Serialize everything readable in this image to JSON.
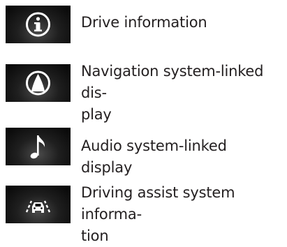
{
  "items": [
    {
      "icon": "info-icon",
      "label": "Drive information"
    },
    {
      "icon": "navigation-arrow-icon",
      "label": "Navigation system-linked dis-\nplay"
    },
    {
      "icon": "music-note-icon",
      "label": "Audio system-linked display"
    },
    {
      "icon": "driving-assist-car-icon",
      "label": "Driving assist system informa-\ntion"
    }
  ],
  "colors": {
    "icon_background": "#111111",
    "icon_foreground": "#ffffff",
    "text": "#231f20"
  }
}
